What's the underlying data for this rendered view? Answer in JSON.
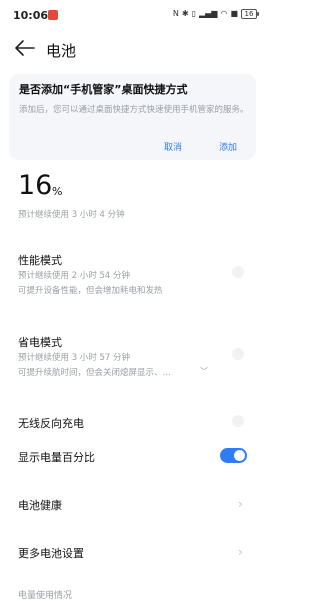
{
  "status_bar": {
    "time": "10:06",
    "battery_level": "16",
    "icons": [
      "nfc-icon",
      "bluetooth-icon",
      "vibrate-icon",
      "signal-icon",
      "wifi-icon",
      "data-icon"
    ]
  },
  "header": {
    "title": "电池"
  },
  "shortcut_card": {
    "title": "是否添加“手机管家”桌面快捷方式",
    "description": "添加后，您可以通过桌面快捷方式快速使用手机管家的服务。",
    "cancel_label": "取消",
    "add_label": "添加"
  },
  "battery": {
    "percent": "16",
    "percent_unit": "%",
    "remaining": "预计继续使用 3 小时 4 分钟"
  },
  "performance_mode": {
    "title": "性能模式",
    "estimate": "预计继续使用 2 小时 54 分钟",
    "description": "可提升设备性能，但会增加耗电和发热",
    "enabled": false
  },
  "power_saving_mode": {
    "title": "省电模式",
    "estimate": "预计继续使用 3 小时 57 分钟",
    "description": "可提升续航时间，但会关闭熄屏显示、…",
    "enabled": false
  },
  "reverse_charging": {
    "title": "无线反向充电",
    "enabled": false
  },
  "show_percentage": {
    "title": "显示电量百分比",
    "enabled": true
  },
  "battery_health": {
    "title": "电池健康"
  },
  "more_settings": {
    "title": "更多电池设置"
  },
  "usage_section": {
    "title": "电量使用情况"
  },
  "colors": {
    "accent": "#2f7cf6",
    "notification": "#e8453c",
    "card_bg": "#f4f6fa"
  }
}
